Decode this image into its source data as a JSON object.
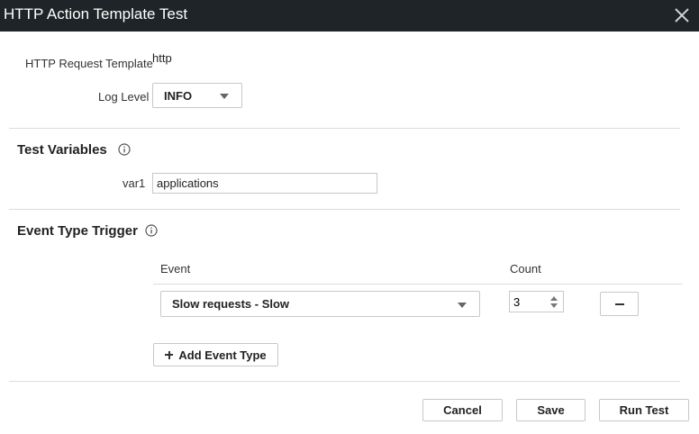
{
  "dialog": {
    "title": "HTTP Action Template Test",
    "close_icon": "close-icon"
  },
  "request": {
    "label": "HTTP Request Template",
    "value": "http"
  },
  "log_level": {
    "label": "Log Level",
    "value": "INFO"
  },
  "test_variables": {
    "heading": "Test Variables",
    "vars": [
      {
        "name": "var1",
        "value": "applications"
      }
    ]
  },
  "event_trigger": {
    "heading": "Event Type Trigger",
    "columns": {
      "event": "Event",
      "count": "Count"
    },
    "rows": [
      {
        "event": "Slow requests - Slow",
        "count": "3"
      }
    ],
    "add_label": "Add Event Type"
  },
  "footer": {
    "cancel": "Cancel",
    "save": "Save",
    "run": "Run Test"
  },
  "colors": {
    "titlebar": "#1f2428",
    "border": "#c8c8c8",
    "divider": "#dcdcdc"
  }
}
